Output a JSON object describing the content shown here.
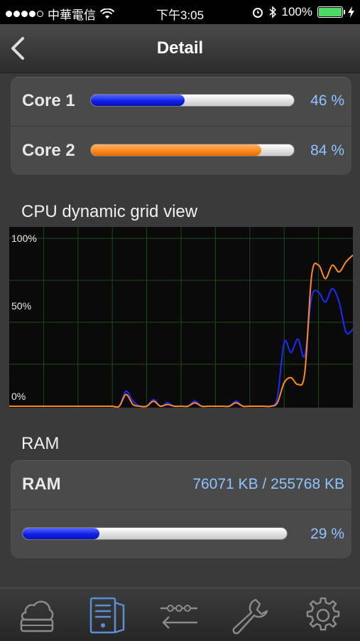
{
  "status": {
    "carrier": "中華電信",
    "time": "下午3:05",
    "battery": "100%"
  },
  "nav": {
    "title": "Detail"
  },
  "cores": [
    {
      "label": "Core 1",
      "value": "46 %",
      "fill": 0.46,
      "color": "#1020e8"
    },
    {
      "label": "Core 2",
      "value": "84 %",
      "fill": 0.84,
      "color": "#ff8a1e"
    }
  ],
  "cpu_section": {
    "title": "CPU dynamic grid view"
  },
  "chart_data": {
    "type": "line",
    "yticks": [
      "100%",
      "50%",
      "0%"
    ],
    "ylim": [
      0,
      100
    ],
    "x": [
      0,
      1,
      2,
      3,
      4,
      5,
      6,
      7,
      8,
      9,
      10,
      11,
      12,
      13,
      14,
      15,
      16,
      17,
      18,
      19,
      20,
      21,
      22,
      23,
      24,
      25,
      26,
      27,
      28,
      29,
      30,
      31,
      32,
      33,
      34,
      35,
      36,
      37,
      38,
      39,
      40,
      41,
      42,
      43,
      44,
      45,
      46,
      47,
      48,
      49,
      50
    ],
    "series": [
      {
        "color": "#1a2cff",
        "values": [
          0,
          0,
          0,
          0,
          0,
          0,
          0,
          0,
          0,
          0,
          0,
          0,
          0,
          0,
          0,
          0,
          0,
          9,
          3,
          0,
          0,
          4,
          0,
          2,
          0,
          0,
          0,
          3,
          0,
          0,
          0,
          0,
          0,
          3,
          0,
          0,
          0,
          0,
          0,
          5,
          38,
          32,
          40,
          30,
          65,
          68,
          62,
          70,
          62,
          44,
          46
        ]
      },
      {
        "color": "#ff8a1e",
        "values": [
          0,
          0,
          0,
          0,
          0,
          0,
          0,
          0,
          0,
          0,
          0,
          0,
          0,
          0,
          0,
          0,
          0,
          7,
          1,
          0,
          0,
          3,
          0,
          1,
          0,
          0,
          0,
          2,
          0,
          0,
          0,
          0,
          0,
          2,
          0,
          0,
          0,
          0,
          0,
          2,
          14,
          17,
          13,
          20,
          78,
          84,
          76,
          84,
          80,
          86,
          90
        ]
      }
    ]
  },
  "ram_section": {
    "title": "RAM"
  },
  "ram": {
    "label": "RAM",
    "value": "76071 KB / 255768 KB",
    "percent": "29 %",
    "fill": 0.29
  },
  "tabs": [
    {
      "name": "cloud-drive-icon"
    },
    {
      "name": "server-icon",
      "selected": true
    },
    {
      "name": "network-transfer-icon"
    },
    {
      "name": "wrench-icon"
    },
    {
      "name": "gear-icon"
    }
  ]
}
